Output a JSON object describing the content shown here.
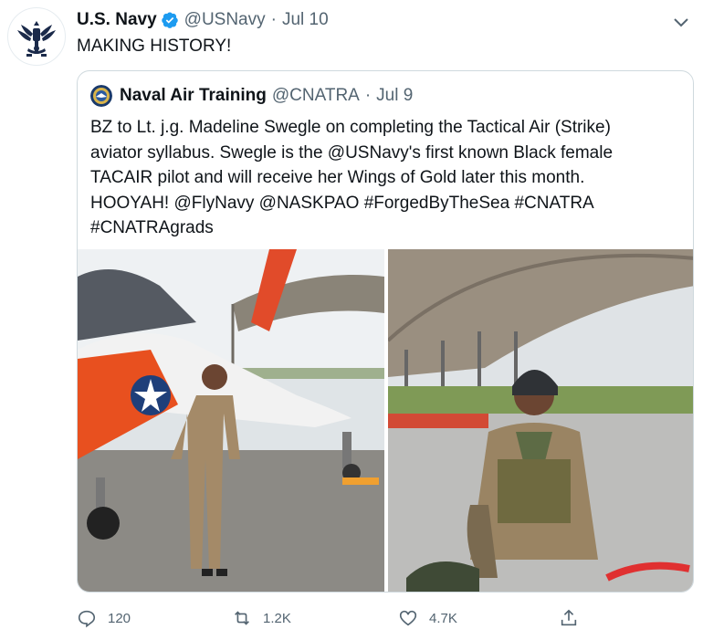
{
  "tweet": {
    "author_name": "U.S. Navy",
    "handle": "@USNavy",
    "separator": "·",
    "date": "Jul 10",
    "text": "MAKING HISTORY!",
    "icons": {
      "avatar": "us-navy-eagle-emblem",
      "verified": "verified-badge-icon",
      "more": "chevron-down-icon"
    }
  },
  "quoted": {
    "author_name": "Naval Air Training",
    "handle": "@CNATRA",
    "separator": "·",
    "date": "Jul 9",
    "text_lines": [
      "BZ to Lt. j.g. Madeline Swegle on completing the Tactical Air (Strike)",
      "aviator syllabus. Swegle is the @USNavy's first known Black female",
      "TACAIR pilot and will receive her Wings of Gold later this month.",
      "HOOYAH! @FlyNavy @NASKPAO #ForgedByTheSea #CNATRA",
      "#CNATRAgrads"
    ],
    "media": [
      "photo-pilot-in-front-of-jet",
      "photo-pilot-in-helmet-under-hangar"
    ]
  },
  "actions": {
    "reply_count": "120",
    "retweet_count": "1.2K",
    "like_count": "4.7K",
    "icons": [
      "reply-icon",
      "retweet-icon",
      "like-icon",
      "share-icon"
    ]
  },
  "colors": {
    "verified": "#1d9bf0",
    "secondary_text": "#536471",
    "border": "#cfd9de"
  }
}
